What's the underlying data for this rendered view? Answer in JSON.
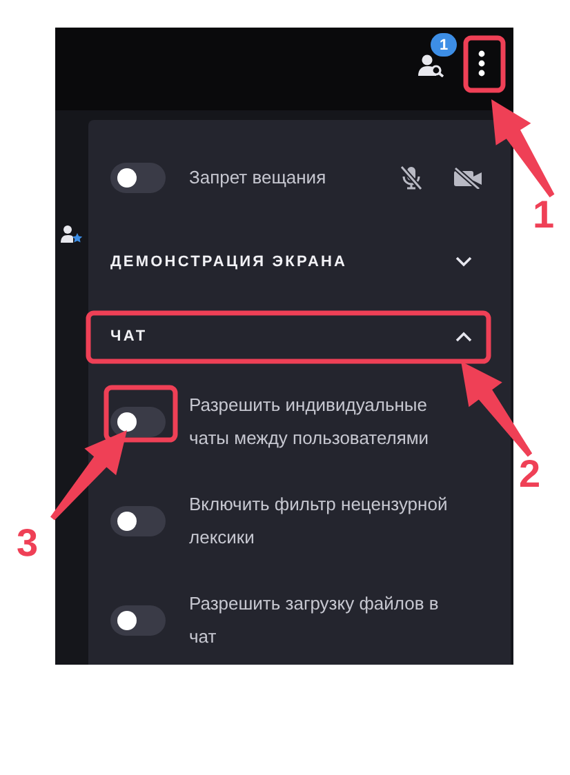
{
  "top_bar": {
    "participants_badge": "1"
  },
  "settings_panel": [
    {
      "kind": "media_toggle",
      "label": "Запрет вещания",
      "checked": false
    },
    {
      "kind": "section",
      "label": "ДЕМОНСТРАЦИЯ ЭКРАНА",
      "expanded": false
    },
    {
      "kind": "section",
      "label": "ЧАТ",
      "expanded": true
    },
    {
      "kind": "toggle",
      "label": "Разрешить индивидуальные чаты между пользователями",
      "checked": false
    },
    {
      "kind": "toggle",
      "label": "Включить фильтр нецензурной лексики",
      "checked": false
    },
    {
      "kind": "toggle",
      "label": "Разрешить загрузку файлов в чат",
      "checked": false
    }
  ],
  "annotations": [
    {
      "number": "1"
    },
    {
      "number": "2"
    },
    {
      "number": "3"
    }
  ]
}
